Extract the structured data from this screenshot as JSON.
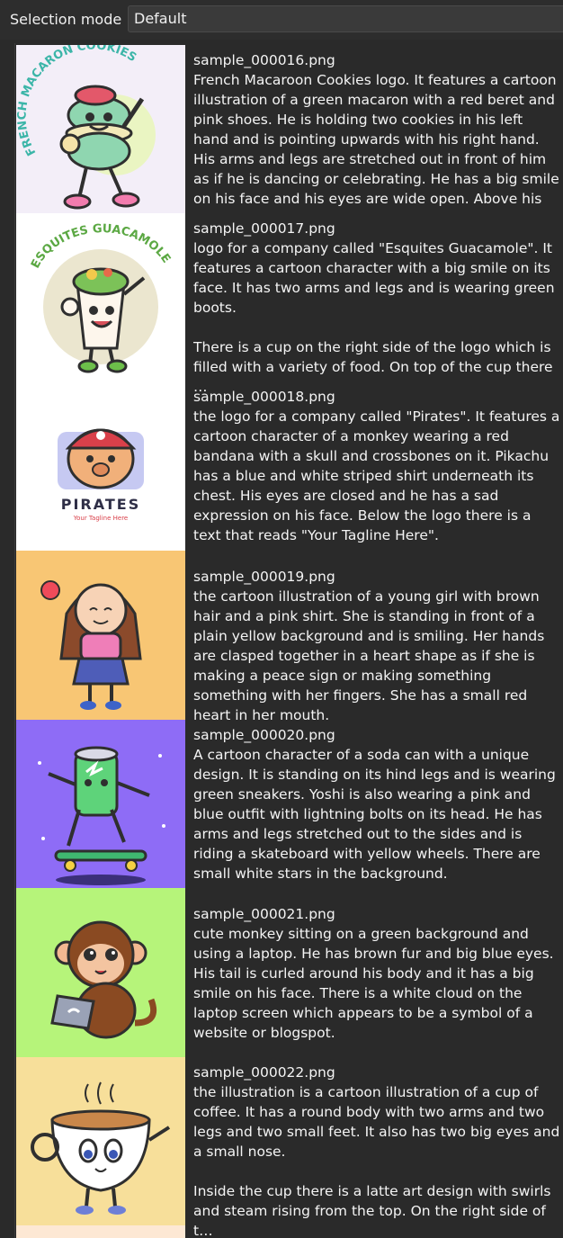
{
  "toolbar": {
    "selection_mode_label": "Selection mode",
    "selection_mode_value": "Default"
  },
  "items": [
    {
      "filename": "sample_000016.png",
      "description": "French Macaroon Cookies logo. It features a cartoon illustration of a green macaron with a red beret and pink shoes. He is holding two cookies in his left hand and is pointing upwards with his right hand. His arms and legs are stretched out in front of him as if he is dancing or celebrating. He has a big smile on his face and his eyes are wide open. Above his head there is …",
      "thumb_bg": "#f3eef8",
      "thumb_text": "FRENCH MACARON COOKIES"
    },
    {
      "filename": "sample_000017.png",
      "description": "logo for a company called \"Esquites Guacamole\". It features a cartoon character with a big smile on its face. It has two arms and legs and is wearing green boots.\n\nThere is a cup on the right side of the logo which is filled with a variety of food. On top of the cup there …",
      "thumb_bg": "#ffffff",
      "thumb_text": "ESQUITES GUACAMOLE"
    },
    {
      "filename": "sample_000018.png",
      "description": "the logo for a company called \"Pirates\". It features a cartoon character of a monkey wearing a red bandana with a skull and crossbones on it. Pikachu has a blue and white striped shirt underneath its chest. His eyes are closed and he has a sad expression on his face. Below the logo there is a text that reads \"Your Tagline Here\".",
      "thumb_bg": "#ffffff",
      "thumb_text": "PIRATES",
      "thumb_subtext": "Your Tagline Here"
    },
    {
      "filename": "sample_000019.png",
      "description": "the cartoon illustration of a young girl with brown hair and a pink shirt. She is standing in front of a plain yellow background and is smiling. Her hands are clasped together in a heart shape as if she is making a peace sign or making something something with her fingers. She has a small red heart in her mouth.",
      "thumb_bg": "#f8c674"
    },
    {
      "filename": "sample_000020.png",
      "description": "A cartoon character of a soda can with a unique design. It is standing on its hind legs and is wearing green sneakers. Yoshi is also wearing a pink and blue outfit with lightning bolts on its head. He has arms and legs stretched out to the sides and is riding a skateboard with yellow wheels. There are small white stars in the background.",
      "thumb_bg": "#8e6cf6"
    },
    {
      "filename": "sample_000021.png",
      "description": "cute monkey sitting on a green background and using a laptop. He has brown fur and big blue eyes. His tail is curled around his body and it has a big smile on his face. There is a white cloud on the laptop screen which appears to be a symbol of a website or blogspot.",
      "thumb_bg": "#b6f47a"
    },
    {
      "filename": "sample_000022.png",
      "description": "the illustration is a cartoon illustration of a cup of coffee. It has a round body with two arms and two legs and two small feet. It also has two big eyes and a small nose.\n\nInside the cup there is a latte art design with swirls and steam rising from the top. On the right side of t…",
      "thumb_bg": "#f7df9a"
    }
  ]
}
